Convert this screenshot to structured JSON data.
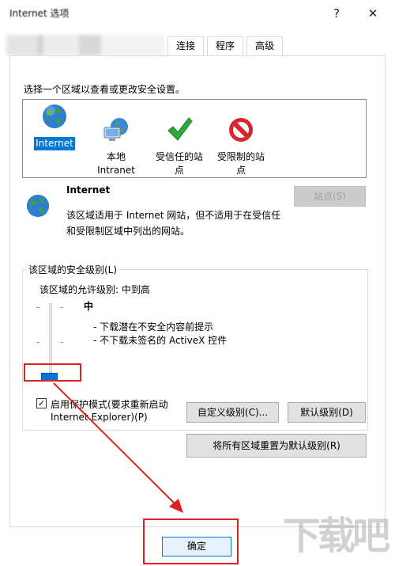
{
  "window": {
    "title": "Internet 选项",
    "help_glyph": "?",
    "close_glyph": "✕"
  },
  "tabs": [
    "连接",
    "程序",
    "高级"
  ],
  "security": {
    "prompt": "选择一个区域以查看或更改安全设置。",
    "zones": [
      {
        "label": "Internet",
        "icon": "globe-icon",
        "selected": true
      },
      {
        "label": "本地\nIntranet",
        "icon": "intranet-computer-icon"
      },
      {
        "label": "受信任的站\n点",
        "icon": "green-check-icon"
      },
      {
        "label": "受限制的站\n点",
        "icon": "restricted-icon"
      }
    ],
    "zone_title": "Internet",
    "zone_description_line1": "该区域适用于 Internet 网站，但不适用于在受信任",
    "zone_description_line2": "和受限制区域中列出的网站。",
    "sites_button": "站点(S)",
    "group_title": "该区域的安全级别(L)",
    "allowed_levels": "该区域的允许级别: 中到高",
    "level_name": "中",
    "level_bullets": [
      "- 下载潜在不安全内容前提示",
      "- 不下载未签名的 ActiveX 控件"
    ],
    "protected_mode_line1": "启用保护模式(要求重新启动",
    "protected_mode_line2": "Internet Explorer)(P)",
    "protected_mode_checked": true,
    "custom_level_button": "自定义级别(C)...",
    "default_level_button": "默认级别(D)",
    "reset_all_button": "将所有区域重置为默认级别(R)"
  },
  "ok_button": "确定",
  "annotation_color": "#e02020",
  "watermark": "下载吧"
}
